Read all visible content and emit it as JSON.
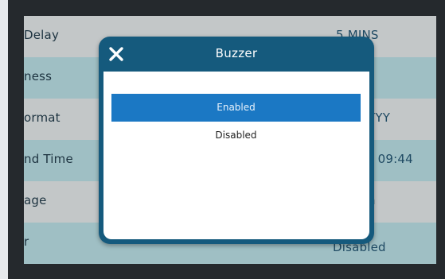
{
  "settings_rows": [
    {
      "label": "Delay",
      "value": "5 MINS"
    },
    {
      "label": "ness",
      "value": ""
    },
    {
      "label": "ormat",
      "value": "YYY"
    },
    {
      "label": "nd Time",
      "value": "– 09:44"
    },
    {
      "label": "age",
      "value": "h"
    },
    {
      "label": "r",
      "value": "Disabled"
    }
  ],
  "modal": {
    "title": "Buzzer",
    "close_icon": "close-icon",
    "options": [
      {
        "label": "Enabled",
        "selected": true
      },
      {
        "label": "Disabled",
        "selected": false
      }
    ]
  },
  "colors": {
    "frame": "#25292d",
    "modal_header": "#155a7d",
    "selected_option": "#1b78c4",
    "row_light": "#c3c7c8",
    "row_teal": "#9fbfc4"
  }
}
